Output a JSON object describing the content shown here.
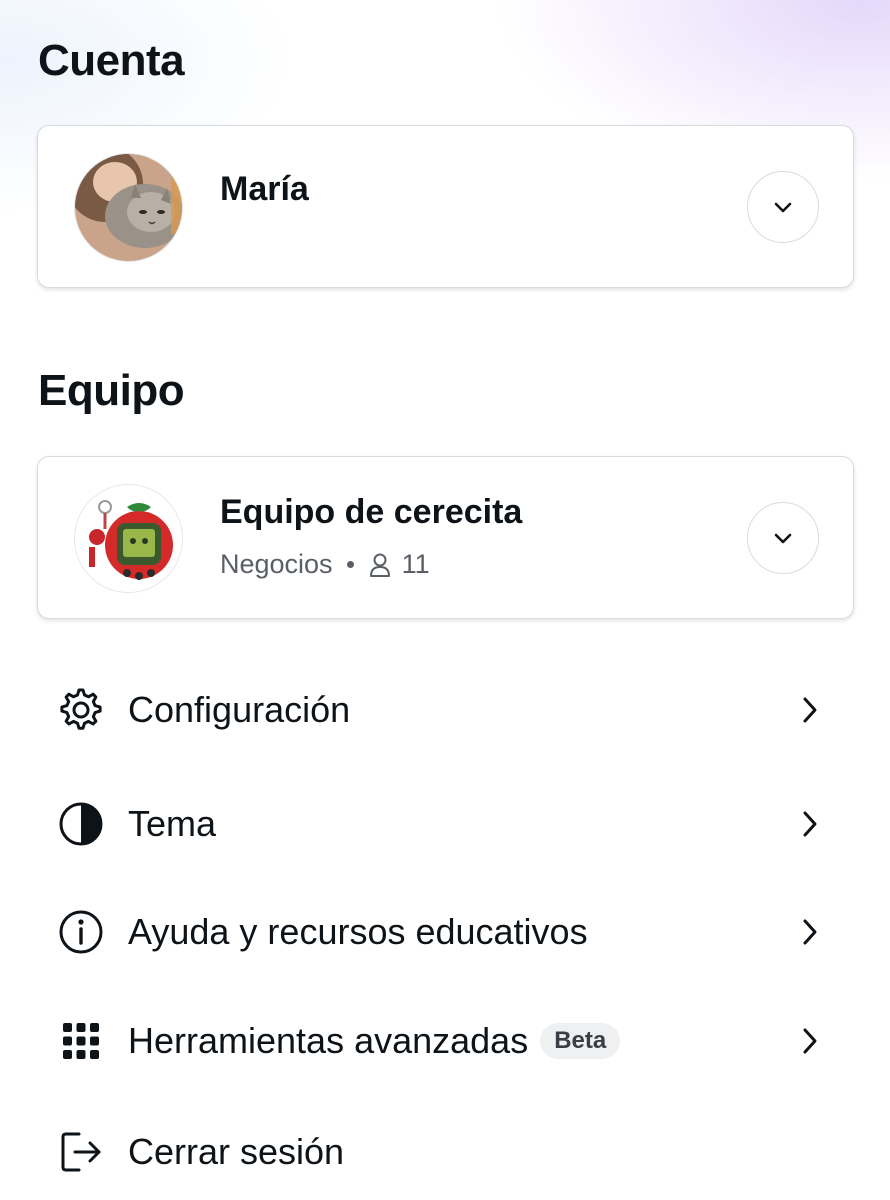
{
  "account": {
    "title": "Cuenta",
    "user_name": "María"
  },
  "team": {
    "title": "Equipo",
    "team_name": "Equipo de cerecita",
    "plan": "Negocios",
    "member_count": "11"
  },
  "menu": {
    "items": [
      {
        "label": "Configuración",
        "icon": "gear-icon"
      },
      {
        "label": "Tema",
        "icon": "theme-contrast-icon"
      },
      {
        "label": "Ayuda y recursos educativos",
        "icon": "info-icon"
      },
      {
        "label": "Herramientas avanzadas",
        "icon": "grid-apps-icon",
        "badge": "Beta"
      },
      {
        "label": "Cerrar sesión",
        "icon": "logout-icon"
      }
    ]
  },
  "colors": {
    "text": "#0e1318",
    "secondary_text": "#5a5f66",
    "border": "#d8dbe0",
    "accent_gradient": "#e4d6fa"
  }
}
